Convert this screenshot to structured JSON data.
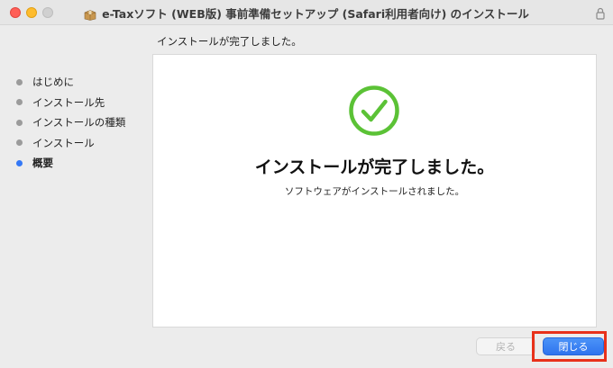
{
  "window": {
    "title": "e-Taxソフト (WEB版) 事前準備セットアップ (Safari利用者向け) のインストール"
  },
  "heading": "インストールが完了しました。",
  "steps": [
    {
      "label": "はじめに",
      "active": false
    },
    {
      "label": "インストール先",
      "active": false
    },
    {
      "label": "インストールの種類",
      "active": false
    },
    {
      "label": "インストール",
      "active": false
    },
    {
      "label": "概要",
      "active": true
    }
  ],
  "panel": {
    "status_icon": "check-circle-icon",
    "main_message": "インストールが完了しました。",
    "sub_message": "ソフトウェアがインストールされました。"
  },
  "buttons": {
    "back_label": "戻る",
    "close_label": "閉じる"
  },
  "colors": {
    "success_green": "#5bc236",
    "accent_blue": "#3478f6",
    "highlight_red": "#e8311a"
  }
}
